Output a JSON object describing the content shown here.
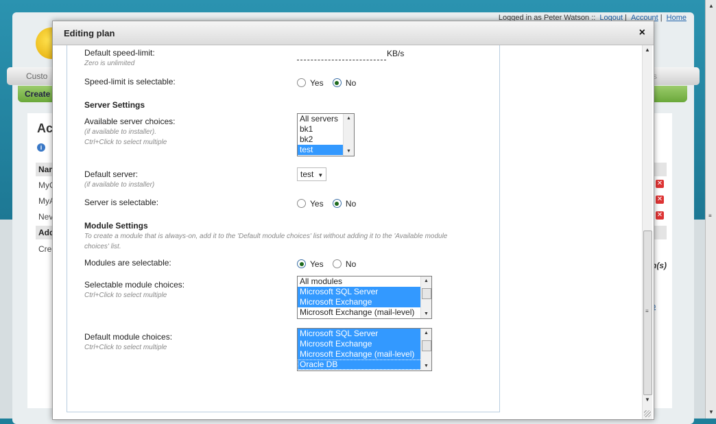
{
  "background": {
    "topbar": {
      "logged_in": "Logged in as Peter Watson ::",
      "logout": "Logout",
      "account": "Account",
      "home": "Home"
    },
    "nav_left": "Custo",
    "nav_right": "ns",
    "green_bar": "Create",
    "heading": "Ac",
    "info_text": "i",
    "table_header": "Nar",
    "rows": [
      "MyC",
      "MyA",
      "Nev"
    ],
    "add_row": "Add",
    "create_link": "Cre",
    "right_label": "n(s)",
    "right_link": "o"
  },
  "modal": {
    "title": "Editing plan",
    "close": "×"
  },
  "form": {
    "speed_limit": {
      "label": "Default speed-limit:",
      "hint": "Zero is unlimited",
      "value": "",
      "unit": "KB/s"
    },
    "speed_selectable": {
      "label": "Speed-limit is selectable:",
      "yes": "Yes",
      "no": "No",
      "selected": "No"
    },
    "server_section": "Server Settings",
    "server_choices": {
      "label": "Available server choices:",
      "hint1": "(if available to installer).",
      "hint2": "Ctrl+Click to select multiple",
      "options": [
        "All servers",
        "bk1",
        "bk2",
        "test"
      ],
      "selected": [
        "test"
      ]
    },
    "default_server": {
      "label": "Default server:",
      "hint": "(if available to installer)",
      "value": "test"
    },
    "server_selectable": {
      "label": "Server is selectable:",
      "yes": "Yes",
      "no": "No",
      "selected": "No"
    },
    "module_section": "Module Settings",
    "module_hint": "To create a module that is always-on, add it to the 'Default module choices' list without adding it to the 'Available module choices' list.",
    "modules_selectable": {
      "label": "Modules are selectable:",
      "yes": "Yes",
      "no": "No",
      "selected": "Yes"
    },
    "selectable_modules": {
      "label": "Selectable module choices:",
      "hint": "Ctrl+Click to select multiple",
      "options": [
        "All modules",
        "Microsoft SQL Server",
        "Microsoft Exchange",
        "Microsoft Exchange (mail-level)"
      ],
      "selected": [
        "Microsoft SQL Server",
        "Microsoft Exchange"
      ]
    },
    "default_modules": {
      "label": "Default module choices:",
      "hint": "Ctrl+Click to select multiple",
      "options": [
        "Microsoft SQL Server",
        "Microsoft Exchange",
        "Microsoft Exchange (mail-level)",
        "Oracle DB"
      ],
      "selected": [
        "Microsoft SQL Server",
        "Microsoft Exchange",
        "Microsoft Exchange (mail-level)",
        "Oracle DB"
      ]
    }
  },
  "colors": {
    "selection": "#3399ff",
    "accent_green": "#6aa83a",
    "header_blue": "#2b93b0"
  }
}
